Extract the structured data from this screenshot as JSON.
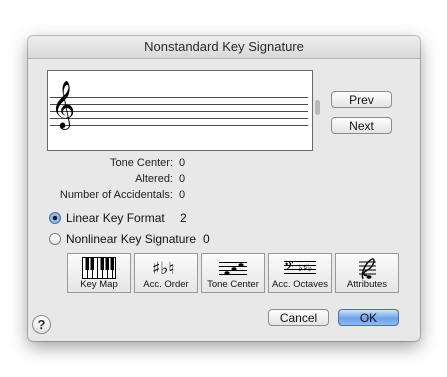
{
  "dialog": {
    "title": "Nonstandard Key Signature"
  },
  "preview": {
    "clef_glyph": "𝄞",
    "clef_icon": "treble-clef-icon"
  },
  "navigation": {
    "prev_label": "Prev",
    "next_label": "Next"
  },
  "info": {
    "tone_center_label": "Tone Center:",
    "tone_center_value": "0",
    "altered_label": "Altered:",
    "altered_value": "0",
    "accidentals_label": "Number of Accidentals:",
    "accidentals_value": "0"
  },
  "format": {
    "linear_label": "Linear Key Format",
    "linear_value": "2",
    "linear_selected": true,
    "nonlinear_label": "Nonlinear Key Signature",
    "nonlinear_value": "0",
    "nonlinear_selected": false
  },
  "tools": [
    {
      "label": "Key Map",
      "icon": "piano-keys-icon"
    },
    {
      "label": "Acc. Order",
      "icon": "accidentals-icon"
    },
    {
      "label": "Tone Center",
      "icon": "tone-center-staff-icon"
    },
    {
      "label": "Acc. Octaves",
      "icon": "bass-clef-staff-icon"
    },
    {
      "label": "Attributes",
      "icon": "attributes-icon"
    }
  ],
  "footer": {
    "help_label": "?",
    "cancel_label": "Cancel",
    "ok_label": "OK"
  },
  "colors": {
    "default_button": "#6ca3e6",
    "window_bg": "#e8e8e8"
  }
}
